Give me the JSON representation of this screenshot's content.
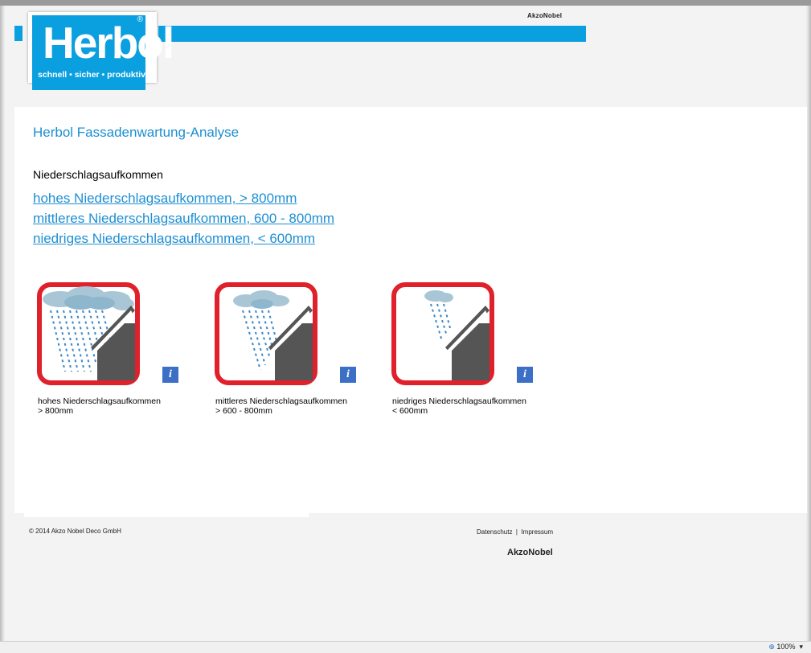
{
  "header": {
    "brand_small": "AkzoNobel",
    "logo": {
      "name": "Herbol",
      "tagline": "schnell • sicher • produktiv",
      "registered": "®"
    }
  },
  "main": {
    "title": "Herbol Fassadenwartung-Analyse",
    "section_label": "Niederschlagsaufkommen",
    "links": [
      "hohes Niederschlagsaufkommen, > 800mm",
      "mittleres Niederschlagsaufkommen, 600 - 800mm",
      "niedriges Niederschlagsaufkommen, < 600mm"
    ],
    "cards": [
      {
        "line1": "hohes Niederschlagsaufkommen",
        "line2": "> 800mm",
        "icon": "heavy-rain-house-icon"
      },
      {
        "line1": "mittleres Niederschlagsaufkommen",
        "line2": "> 600 - 800mm",
        "icon": "medium-rain-house-icon"
      },
      {
        "line1": "niedriges Niederschlagsaufkommen",
        "line2": "< 600mm",
        "icon": "light-rain-house-icon"
      }
    ],
    "info_glyph": "i"
  },
  "footer": {
    "copyright": "© 2014 Akzo Nobel Deco GmbH",
    "datenschutz": "Datenschutz",
    "separator": "|",
    "impressum": "Impressum",
    "brand": "AkzoNobel"
  },
  "statusbar": {
    "zoom": "100%"
  },
  "colors": {
    "accent": "#0aa0e0",
    "link": "#1e8fd3",
    "frame_red": "#e0202a",
    "house": "#555555",
    "info": "#3c6fc6"
  }
}
